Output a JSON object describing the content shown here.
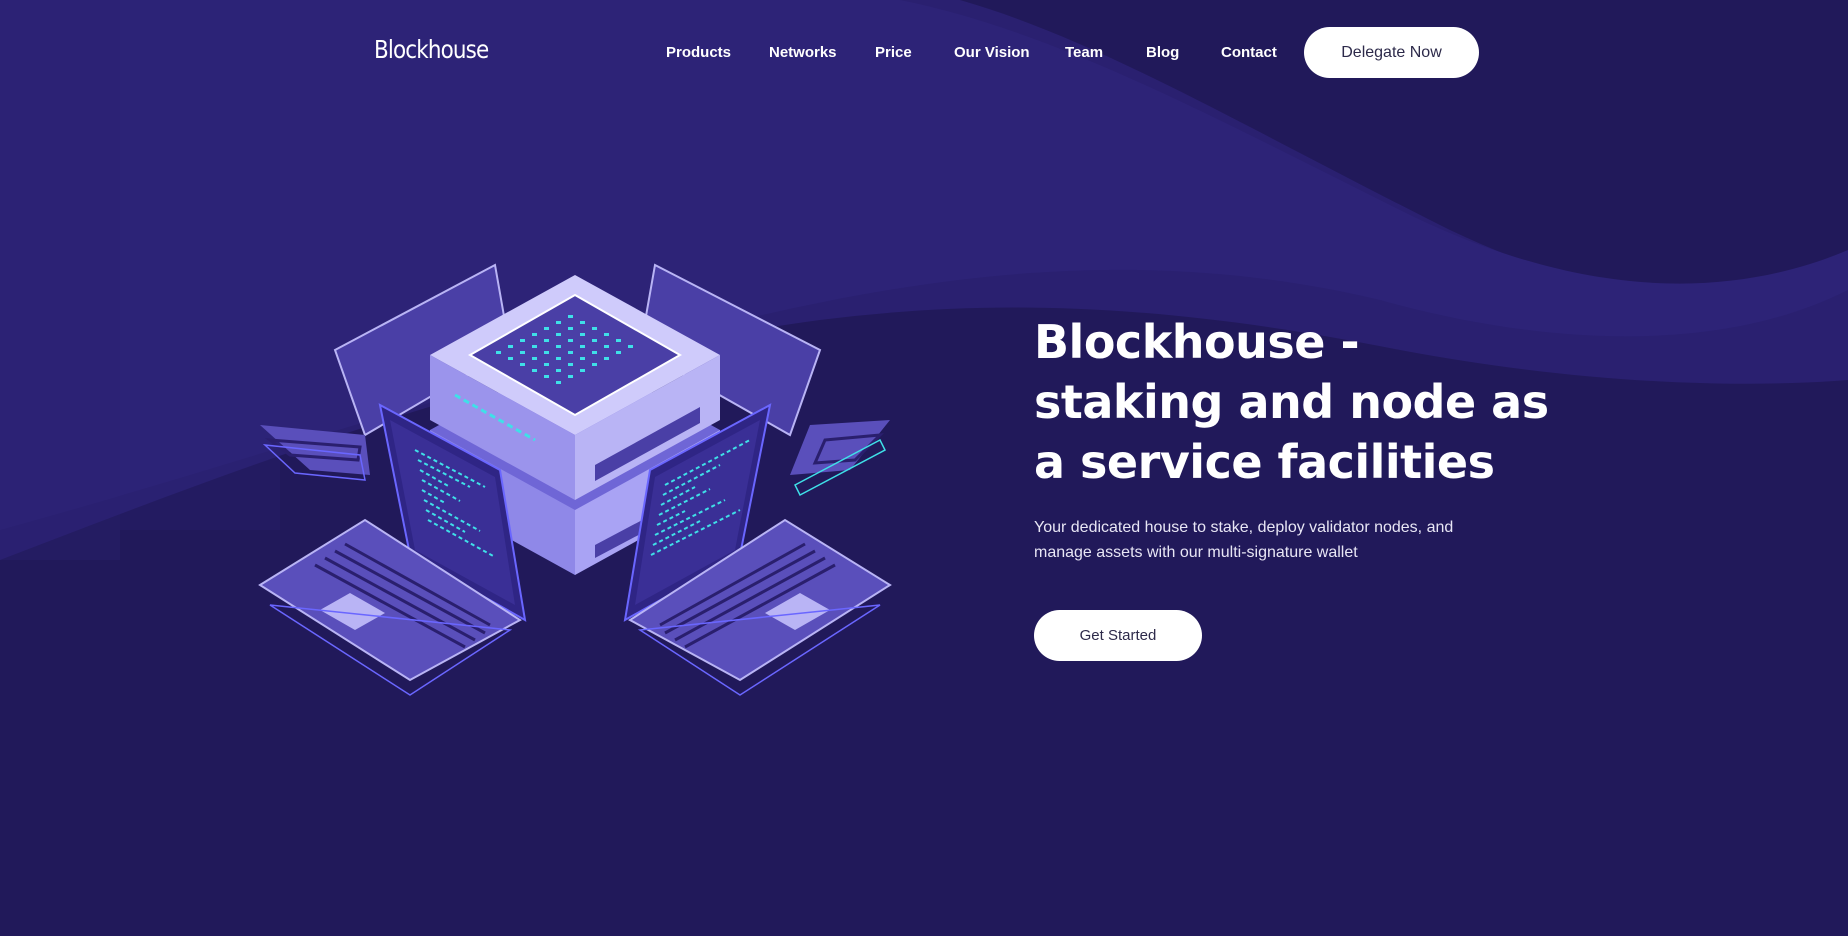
{
  "brand": {
    "name": "Blockhouse"
  },
  "nav": {
    "items": [
      {
        "label": "Products"
      },
      {
        "label": "Networks"
      },
      {
        "label": "Price"
      },
      {
        "label": "Our Vision"
      },
      {
        "label": "Team"
      },
      {
        "label": "Blog"
      },
      {
        "label": "Contact"
      }
    ],
    "cta_label": "Delegate Now"
  },
  "hero": {
    "title": "Blockhouse - staking and node as a service facilities",
    "subtitle": "Your dedicated house to stake, deploy validator nodes, and manage assets with our multi-signature wallet",
    "cta_label": "Get Started"
  },
  "colors": {
    "background": "#21195a",
    "wave_light": "#2c2272",
    "accent_cyan": "#3fe0e8",
    "device_light": "#b9b4f5",
    "device_mid": "#4a3fa6",
    "button_text": "#2d2a4a"
  },
  "illustration": {
    "icon": "server-network-illustration-icon"
  }
}
